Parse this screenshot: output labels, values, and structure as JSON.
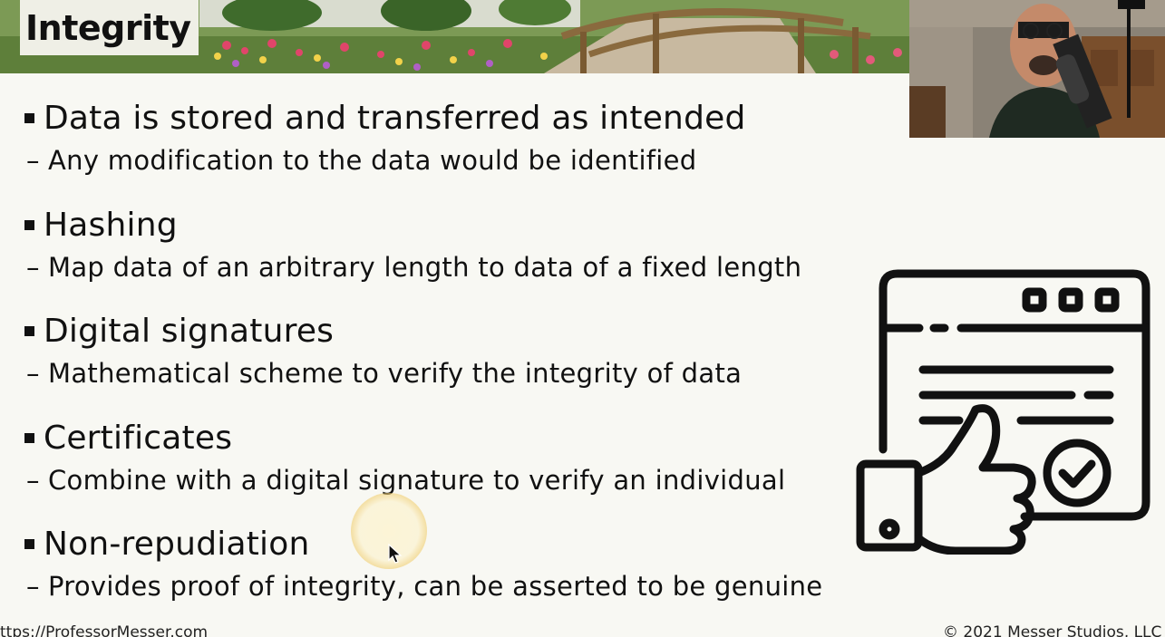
{
  "slide": {
    "title": "Integrity",
    "bullets": [
      {
        "heading": "Data is stored and transferred as intended",
        "detail": "Any modification to the data would be identified"
      },
      {
        "heading": "Hashing",
        "detail": "Map data of an arbitrary length to data of a fixed length"
      },
      {
        "heading": "Digital signatures",
        "detail": "Mathematical scheme to verify the integrity of data"
      },
      {
        "heading": "Certificates",
        "detail": "Combine with a digital signature to verify an individual"
      },
      {
        "heading": "Non-repudiation",
        "detail": "Provides proof of integrity, can be asserted to be genuine"
      }
    ],
    "dash_glyph": "–",
    "footer_left": "ttps://ProfessorMesser.com",
    "footer_right": "© 2021 Messer Studios, LLC"
  },
  "icons": {
    "illustration": "certificate-thumbs-up-icon",
    "bullet": "square-bullet-icon",
    "cursor": "mouse-pointer-icon"
  },
  "colors": {
    "background": "#f8f8f3",
    "text": "#111111",
    "title_box": "#efefe6",
    "cursor_highlight": "#f0cd6e"
  }
}
